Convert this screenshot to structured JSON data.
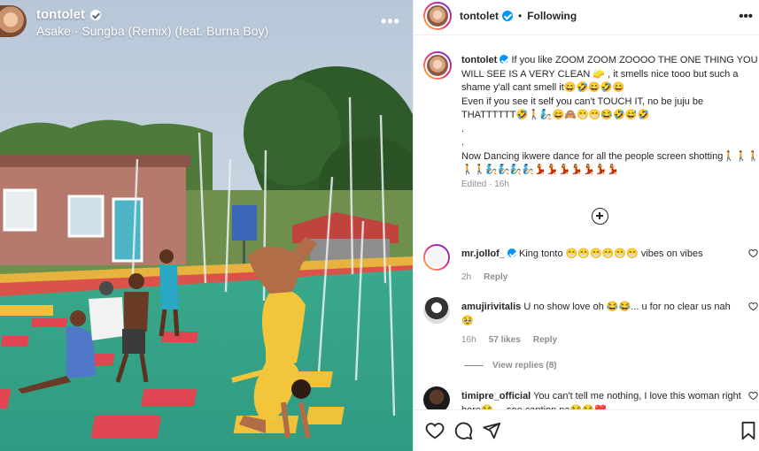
{
  "media": {
    "username": "tontolet",
    "song": "Asake · Sungba (Remix) (feat. Burna Boy)",
    "more_icon": "more-horizontal-icon",
    "sign_text": "🚶"
  },
  "post": {
    "username": "tontolet",
    "separator": "•",
    "follow_status": "Following",
    "more_icon": "more-horizontal-icon"
  },
  "caption": {
    "username": "tontolet",
    "text": "If you like ZOOM ZOOM ZOOOO THE ONE THING YOU WILL SEE IS A VERY CLEAN 🧽 , it smells nice tooo but such a shame y'all cant smell it😄🤣😄🤣😄\nEven if you see it self you can't TOUCH IT, no be juju be THATTTTTT🤣🚶🧞😄🙈😁😁😂🤣😅🤣\n.\n.\nNow Dancing ikwere dance for all the people screen shotting🚶🚶🚶🚶🚶🧞🧞🧞🧞💃💃💃💃💃💃💃",
    "meta": "Edited · 16h"
  },
  "comments": [
    {
      "username": "mr.jollof_",
      "verified": true,
      "text": "King tonto 😁😁😁😁😁😁 vibes on vibes",
      "time": "2h",
      "likes": "",
      "reply": "Reply"
    },
    {
      "username": "amujirivitalis",
      "verified": false,
      "text": "U no show love oh 😂😂... u for no clear us nah 🥹",
      "time": "16h",
      "likes": "57 likes",
      "reply": "Reply"
    },
    {
      "username": "timipre_official",
      "verified": false,
      "text": "You can't tell me nothing, I love this woman right here😂 ... see caption na😂😂❤️",
      "time": "",
      "likes": "",
      "reply": ""
    }
  ],
  "view_replies": "View replies (8)",
  "colors": {
    "verified_blue": "#0095f6",
    "text": "#262626",
    "muted": "#8e8e8e"
  },
  "icons": [
    "heart-icon",
    "comment-icon",
    "share-icon",
    "bookmark-icon",
    "add-comment-icon"
  ]
}
